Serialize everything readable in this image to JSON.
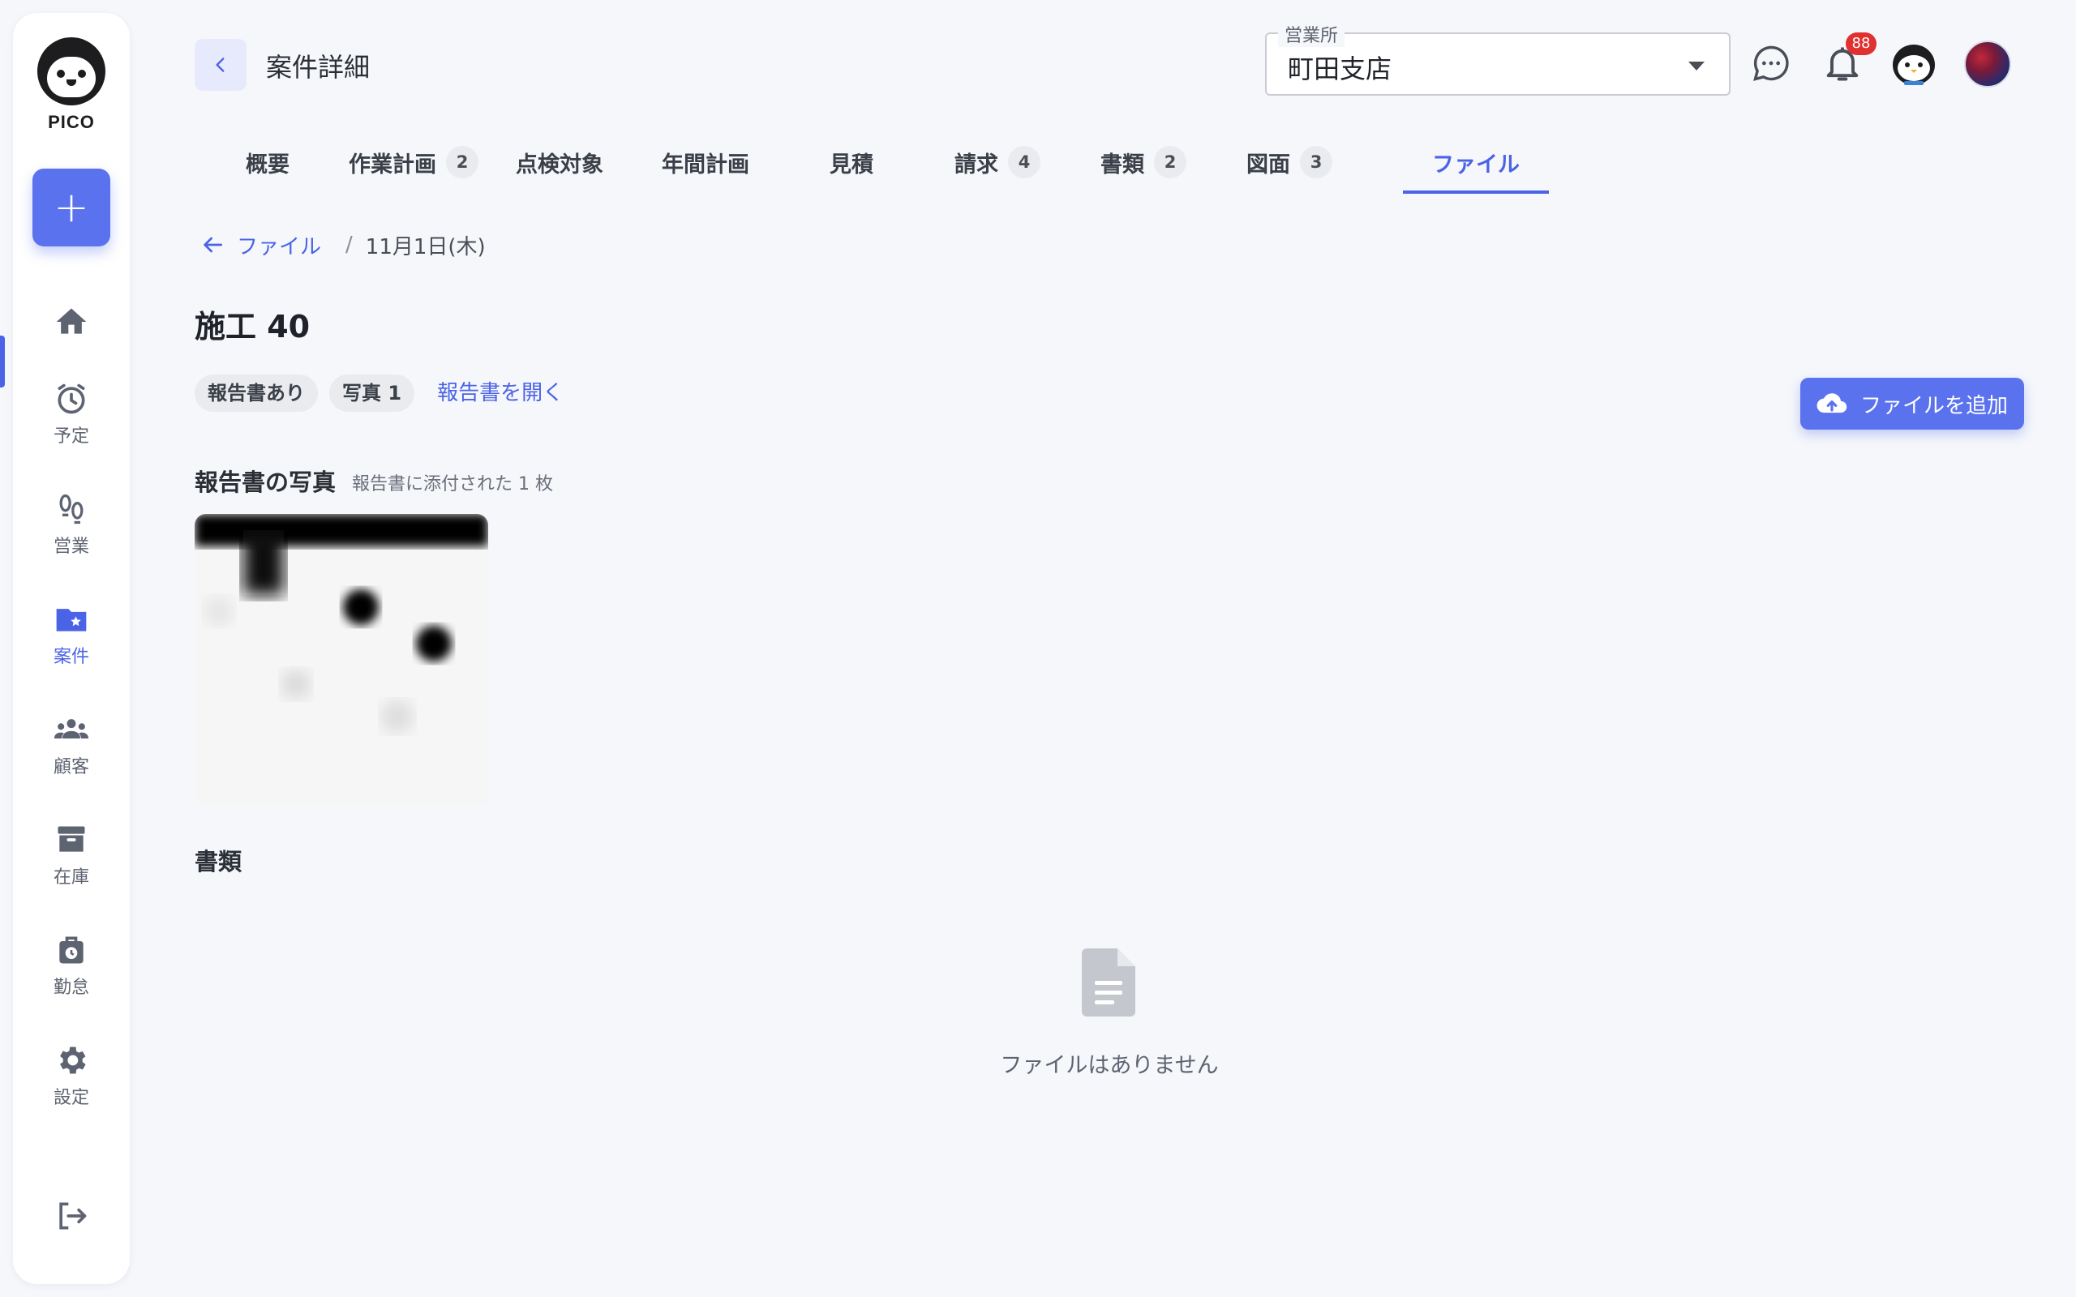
{
  "sidebar": {
    "logo_text": "PICO",
    "add_label": "+",
    "items": [
      {
        "label": "",
        "icon": "home-icon"
      },
      {
        "label": "予定",
        "icon": "alarm-clock-icon"
      },
      {
        "label": "営業",
        "icon": "footprints-icon"
      },
      {
        "label": "案件",
        "icon": "folder-star-icon",
        "active": true
      },
      {
        "label": "顧客",
        "icon": "people-icon"
      },
      {
        "label": "在庫",
        "icon": "archive-box-icon"
      },
      {
        "label": "勤怠",
        "icon": "timecard-icon"
      },
      {
        "label": "設定",
        "icon": "gear-icon"
      }
    ],
    "logout_icon": "logout-icon"
  },
  "header": {
    "title": "案件詳細",
    "office_select": {
      "label": "営業所",
      "value": "町田支店"
    },
    "notification_count": "88"
  },
  "tabs": [
    {
      "label": "概要",
      "count": ""
    },
    {
      "label": "作業計画",
      "count": "2"
    },
    {
      "label": "点検対象",
      "count": ""
    },
    {
      "label": "年間計画",
      "count": ""
    },
    {
      "label": "見積",
      "count": ""
    },
    {
      "label": "請求",
      "count": "4"
    },
    {
      "label": "書類",
      "count": "2"
    },
    {
      "label": "図面",
      "count": "3"
    },
    {
      "label": "ファイル",
      "count": "",
      "active": true
    }
  ],
  "breadcrumb": {
    "link": "ファイル",
    "separator": "/",
    "current": "11月1日(木)"
  },
  "work": {
    "title": "施工 40",
    "chips": [
      "報告書あり",
      "写真 1"
    ],
    "open_report": "報告書を開く"
  },
  "add_file_button": "ファイルを追加",
  "photos": {
    "title": "報告書の写真",
    "subtitle": "報告書に添付された 1 枚"
  },
  "documents": {
    "title": "書類",
    "empty_text": "ファイルはありません"
  },
  "colors": {
    "accent": "#5b72ee",
    "badge": "#e0312f",
    "background": "#f5f7fb"
  }
}
